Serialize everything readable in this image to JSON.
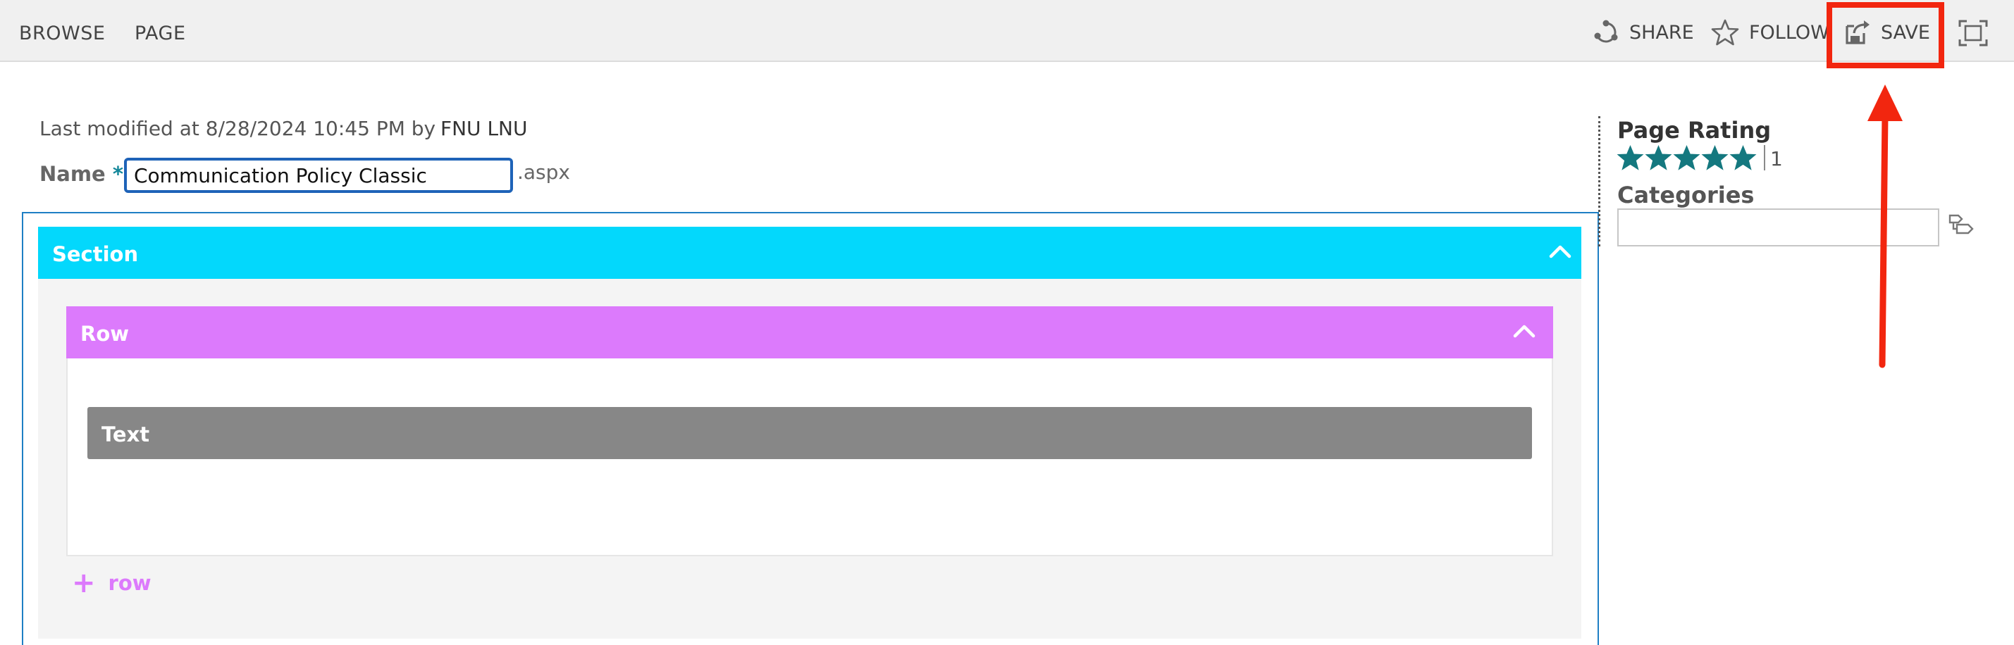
{
  "ribbon": {
    "tabs": [
      {
        "label": "BROWSE"
      },
      {
        "label": "PAGE"
      }
    ],
    "actions": {
      "share": {
        "label": "SHARE",
        "icon": "share-icon"
      },
      "follow": {
        "label": "FOLLOW",
        "icon": "star-outline-icon"
      },
      "save": {
        "label": "SAVE",
        "icon": "save-icon"
      },
      "focus": {
        "icon": "focus-on-content-icon"
      }
    }
  },
  "annotation": {
    "color": "#f2260f"
  },
  "page": {
    "modified_text": "Last modified at 8/28/2024 10:45 PM by",
    "modified_user": "FNU LNU",
    "name_label": "Name",
    "required_marker": "*",
    "name_value": "Communication Policy Classic",
    "extension": ".aspx"
  },
  "layout_blocks": {
    "section_label": "Section",
    "section_color": "#03d8fc",
    "row_label": "Row",
    "row_color": "#dc7afc",
    "text_label": "Text",
    "text_color": "#878787",
    "add_row_label": "row",
    "collapse_icon": "chevron-up-icon"
  },
  "sidebar": {
    "rating_title": "Page Rating",
    "rating_stars": 5,
    "rating_max": 5,
    "rating_count": "1",
    "star_color": "#14787f",
    "categories_title": "Categories",
    "categories_value": "",
    "categories_icon": "browse-tags-icon"
  }
}
